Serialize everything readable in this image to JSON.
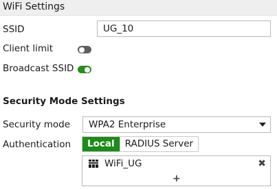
{
  "section": {
    "title": "WiFi Settings"
  },
  "fields": {
    "ssid_label": "SSID",
    "ssid_value": "UG_10",
    "client_limit_label": "Client limit",
    "client_limit_enabled": false,
    "broadcast_ssid_label": "Broadcast SSID",
    "broadcast_ssid_enabled": true
  },
  "security": {
    "title": "Security Mode Settings",
    "mode_label": "Security mode",
    "mode_value": "WPA2 Enterprise",
    "auth_label": "Authentication",
    "auth_options": [
      "Local",
      "RADIUS Server"
    ],
    "auth_selected": "Local",
    "entries": [
      "WiFi_UG"
    ],
    "add_symbol": "+",
    "remove_symbol": "✖"
  },
  "colors": {
    "toggle_on": "#2e8b1f",
    "toggle_off": "#5f5f5f",
    "segment_active": "#1e8a1b",
    "header_bg": "#efefef"
  },
  "icons": {
    "entry": "user-group-icon",
    "remove": "close-icon",
    "add": "plus-icon",
    "dropdown": "caret-down-icon"
  }
}
